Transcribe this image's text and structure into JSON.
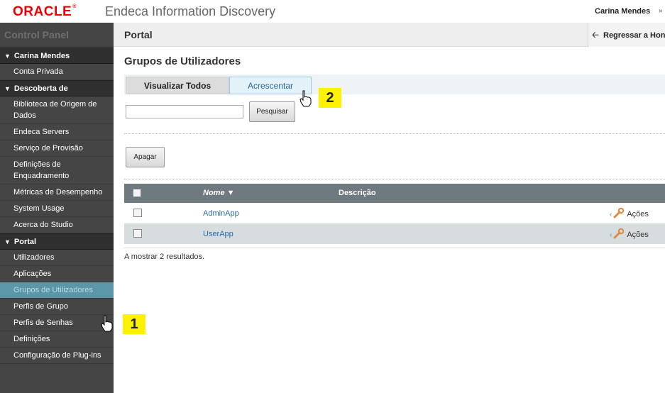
{
  "header": {
    "brand": "ORACLE",
    "app_title": "Endeca Information Discovery",
    "user_name": "Carina Mendes",
    "user_caret": "»"
  },
  "sidebar": {
    "title": "Control Panel",
    "sections": [
      {
        "label": "Carina Mendes",
        "items": [
          "Conta Privada"
        ]
      },
      {
        "label": "Descoberta de",
        "items": [
          "Biblioteca de Origem de Dados",
          "Endeca Servers",
          "Serviço de Provisão",
          "Definições de Enquadramento",
          "Métricas de Desempenho",
          "System Usage",
          "Acerca do Studio"
        ]
      },
      {
        "label": "Portal",
        "items": [
          "Utilizadores",
          "Aplicações",
          "Grupos de Utilizadores",
          "Perfis de Grupo",
          "Perfis de Senhas",
          "Definições",
          "Configuração de Plug-ins"
        ]
      }
    ],
    "active_item": "Grupos de Utilizadores"
  },
  "portal_bar": {
    "title": "Portal",
    "back_link": "Regressar a Hon"
  },
  "main": {
    "section_title": "Grupos de Utilizadores",
    "tabs": [
      "Visualizar Todos",
      "Acrescentar"
    ],
    "search": {
      "value": "",
      "button": "Pesquisar"
    },
    "delete_button": "Apagar",
    "table": {
      "headers": {
        "name": "Nome",
        "sort_indicator": "▼",
        "description": "Descrição"
      },
      "rows": [
        {
          "name": "AdminApp",
          "description": "",
          "actions": "Ações"
        },
        {
          "name": "UserApp",
          "description": "",
          "actions": "Ações"
        }
      ]
    },
    "results_text": "A mostrar 2 resultados."
  },
  "annotations": {
    "badge1": "1",
    "badge2": "2"
  }
}
